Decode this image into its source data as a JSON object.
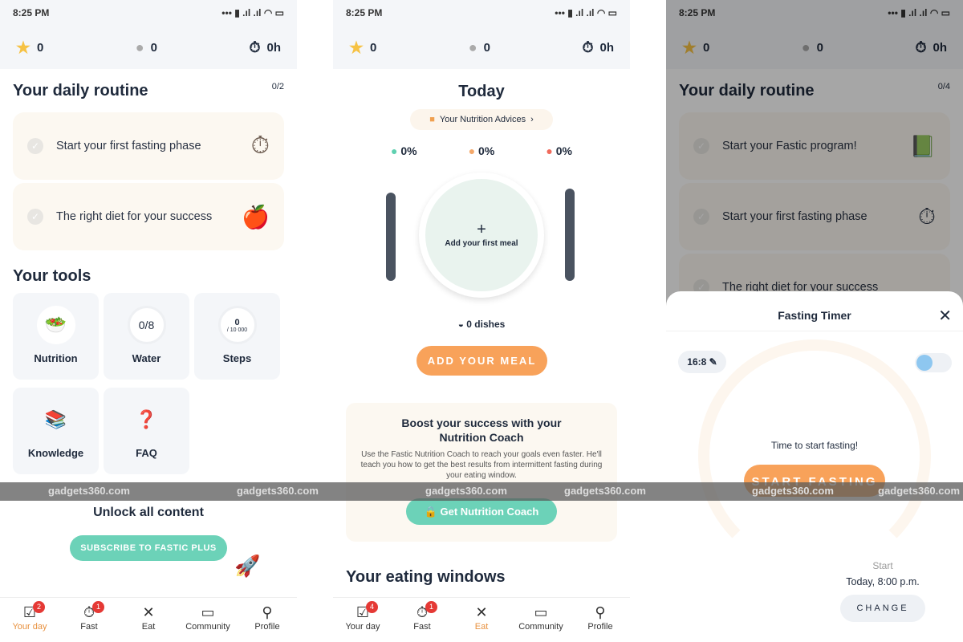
{
  "status_time": "8:25 PM",
  "battery": "6",
  "stats": {
    "stars": "0",
    "streak": "0",
    "hours": "0h"
  },
  "panel1": {
    "routine_title": "Your daily routine",
    "routine_progress": "0/2",
    "tasks": [
      "Start your first fasting phase",
      "The right diet for your success"
    ],
    "tools_title": "Your tools",
    "tools": [
      {
        "label": "Nutrition"
      },
      {
        "label": "Water",
        "value": "0/8"
      },
      {
        "label": "Steps",
        "value": "0",
        "sub": "/ 10 000"
      },
      {
        "label": "Knowledge"
      },
      {
        "label": "FAQ"
      }
    ],
    "unlock_title": "Unlock all content",
    "subscribe_label": "SUBSCRIBE TO FASTIC PLUS"
  },
  "panel2": {
    "title": "Today",
    "advice_label": "Your Nutrition Advices",
    "macros": [
      {
        "value": "0%",
        "color": "#5fd0b0"
      },
      {
        "value": "0%",
        "color": "#f4a86a"
      },
      {
        "value": "0%",
        "color": "#f06b5c"
      }
    ],
    "plate_plus": "+",
    "plate_label": "Add your first meal",
    "dishes": "0 dishes",
    "add_meal_label": "ADD YOUR MEAL",
    "coach_title": "Boost your success with your Nutrition Coach",
    "coach_text": "Use the Fastic Nutrition Coach to reach your goals even faster. He'll teach you how to get the best results from intermittent fasting during your eating window.",
    "coach_button": "Get Nutrition Coach",
    "eating_title": "Your eating windows"
  },
  "panel3": {
    "routine_title": "Your daily routine",
    "routine_progress": "0/4",
    "tasks": [
      "Start your Fastic program!",
      "Start your first fasting phase",
      "The right diet for your success"
    ],
    "sheet_title": "Fasting Timer",
    "plan": "16:8",
    "message": "Time to start fasting!",
    "start_label": "START FASTING",
    "start_caption": "Start",
    "start_time": "Today, 8:00 p.m.",
    "change_label": "CHANGE"
  },
  "nav": {
    "items": [
      "Your day",
      "Fast",
      "Eat",
      "Community",
      "Profile"
    ],
    "badges_p1": [
      "2",
      "1"
    ],
    "badges_p2": [
      "4",
      "1"
    ]
  },
  "watermark": "gadgets360.com",
  "colors": {
    "accent_orange": "#f8a25a",
    "accent_teal": "#6cd2b8",
    "active_nav": "#e8913f"
  }
}
